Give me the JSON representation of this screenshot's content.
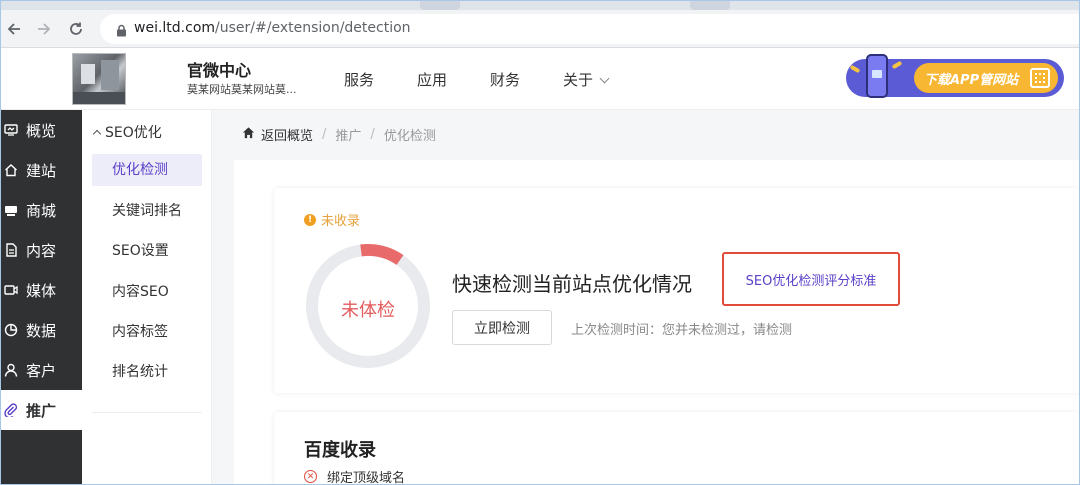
{
  "browser": {
    "url_host": "wei.ltd.com",
    "url_path": "/user/#/extension/detection"
  },
  "header": {
    "brand_title": "官微中心",
    "brand_subtitle": "莫某网站莫某网站莫...",
    "nav": [
      {
        "label": "服务"
      },
      {
        "label": "应用"
      },
      {
        "label": "财务"
      },
      {
        "label": "关于"
      }
    ],
    "app_banner_label": "下载APP管网站"
  },
  "sidebar": {
    "items": [
      {
        "label": "概览",
        "icon": "dashboard-icon"
      },
      {
        "label": "建站",
        "icon": "home-icon"
      },
      {
        "label": "商城",
        "icon": "shop-icon"
      },
      {
        "label": "内容",
        "icon": "document-icon"
      },
      {
        "label": "媒体",
        "icon": "media-icon"
      },
      {
        "label": "数据",
        "icon": "pie-chart-icon"
      },
      {
        "label": "客户",
        "icon": "user-icon"
      },
      {
        "label": "推广",
        "icon": "paperclip-icon",
        "active": true
      }
    ]
  },
  "submenu": {
    "heading": "SEO优化",
    "items": [
      {
        "label": "优化检测",
        "active": true
      },
      {
        "label": "关键词排名"
      },
      {
        "label": "SEO设置"
      },
      {
        "label": "内容SEO"
      },
      {
        "label": "内容标签"
      },
      {
        "label": "排名统计"
      }
    ]
  },
  "breadcrumb": {
    "back": "返回概览",
    "level1": "推广",
    "level2": "优化检测"
  },
  "detection_card": {
    "status": "未收录",
    "gauge_label": "未体检",
    "title": "快速检测当前站点优化情况",
    "criteria_link": "SEO优化检测评分标准",
    "detect_button": "立即检测",
    "last_time": "上次检测时间：您并未检测过，请检测"
  },
  "baidu_card": {
    "title": "百度收录",
    "item": "绑定顶级域名"
  },
  "colors": {
    "accent": "#5b3fc9",
    "sidebar_bg": "#2f3133",
    "warning": "#e6a23c",
    "danger": "#e04b3a"
  }
}
